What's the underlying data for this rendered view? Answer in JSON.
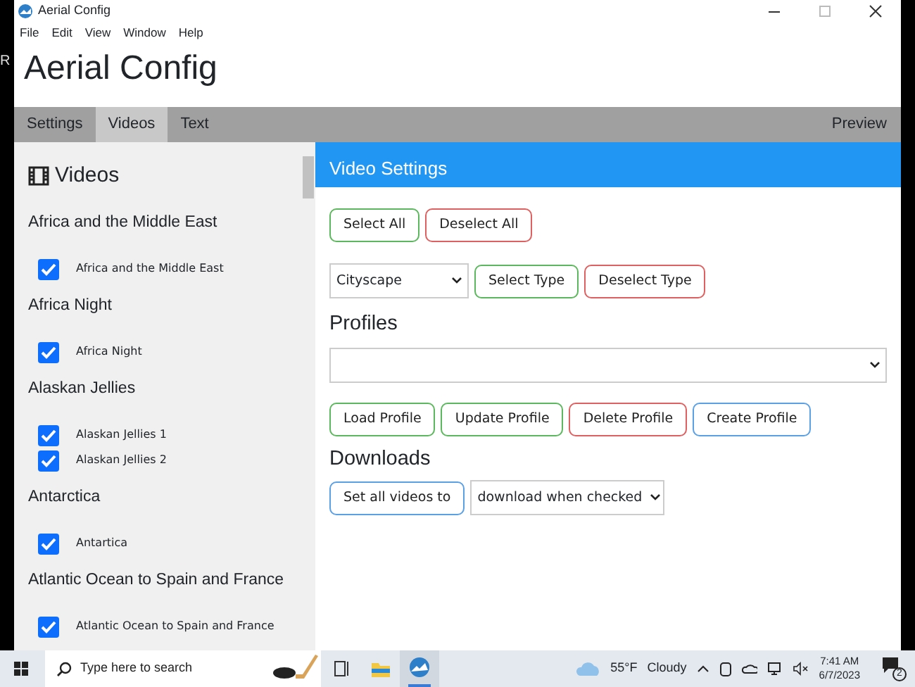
{
  "desktop": {
    "edge_text": "R"
  },
  "window": {
    "title": "Aerial Config"
  },
  "menu": [
    "File",
    "Edit",
    "View",
    "Window",
    "Help"
  ],
  "app_title": "Aerial Config",
  "tabs": [
    {
      "label": "Settings",
      "selected": false
    },
    {
      "label": "Videos",
      "selected": true
    },
    {
      "label": "Text",
      "selected": false
    }
  ],
  "preview_tab": "Preview",
  "sidebar": {
    "heading": "Videos",
    "groups": [
      {
        "title": "Africa and the Middle East",
        "videos": [
          {
            "label": "Africa and the Middle East",
            "checked": true
          }
        ]
      },
      {
        "title": "Africa Night",
        "videos": [
          {
            "label": "Africa Night",
            "checked": true
          }
        ]
      },
      {
        "title": "Alaskan Jellies",
        "videos": [
          {
            "label": "Alaskan Jellies 1",
            "checked": true
          },
          {
            "label": "Alaskan Jellies 2",
            "checked": true
          }
        ]
      },
      {
        "title": "Antarctica",
        "videos": [
          {
            "label": "Antartica",
            "checked": true
          }
        ]
      },
      {
        "title": "Atlantic Ocean to Spain and France",
        "videos": [
          {
            "label": "Atlantic Ocean to Spain and France",
            "checked": true
          }
        ]
      }
    ]
  },
  "panel": {
    "header": "Video Settings",
    "select_buttons": [
      {
        "label": "Select All",
        "kind": "success"
      },
      {
        "label": "Deselect All",
        "kind": "danger"
      }
    ],
    "type_select": {
      "value": "Cityscape"
    },
    "type_buttons": [
      {
        "label": "Select Type",
        "kind": "success"
      },
      {
        "label": "Deselect Type",
        "kind": "danger"
      }
    ],
    "profiles_heading": "Profiles",
    "profile_buttons": [
      {
        "label": "Load Profile",
        "kind": "success"
      },
      {
        "label": "Update Profile",
        "kind": "success"
      },
      {
        "label": "Delete Profile",
        "kind": "danger"
      },
      {
        "label": "Create Profile",
        "kind": "primary"
      }
    ],
    "downloads_heading": "Downloads",
    "set_all_button": {
      "label": "Set all videos to",
      "kind": "primary"
    },
    "download_select": {
      "value": "download when checked"
    }
  },
  "taskbar": {
    "search_placeholder": "Type here to search",
    "temperature": "55°F",
    "weather": "Cloudy",
    "time": "7:41 AM",
    "date": "6/7/2023",
    "notifications": "2"
  }
}
